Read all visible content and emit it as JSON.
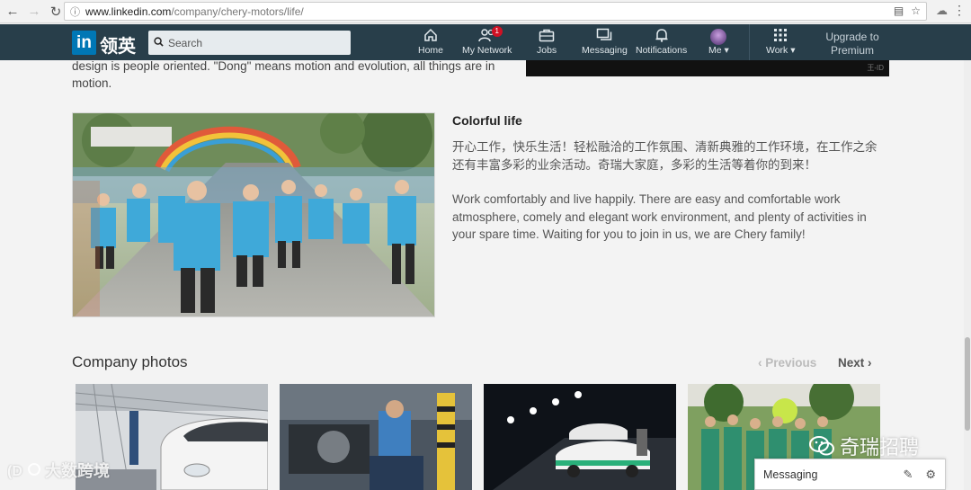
{
  "browser": {
    "back_icon": "back-arrow-icon",
    "forward_icon": "forward-arrow-icon",
    "reload_icon": "reload-icon",
    "url_host": "www.linkedin.com",
    "url_path": "/company/chery-motors/life/"
  },
  "linkedin_nav": {
    "logo_text": "in",
    "logo_cn": "领英",
    "search_placeholder": "Search",
    "items": [
      {
        "label": "Home",
        "icon": "home-icon"
      },
      {
        "label": "My Network",
        "icon": "network-icon",
        "badge": "1"
      },
      {
        "label": "Jobs",
        "icon": "briefcase-icon"
      },
      {
        "label": "Messaging",
        "icon": "messaging-icon"
      },
      {
        "label": "Notifications",
        "icon": "bell-icon"
      },
      {
        "label": "Me ▾",
        "icon": "avatar"
      },
      {
        "label": "Work ▾",
        "icon": "grid-icon"
      }
    ],
    "upgrade": "Upgrade to Premium"
  },
  "video_caption": "王-ID",
  "intro_text": "design is people oriented. \"Dong\" means motion and evolution, all things are in motion.",
  "colorful_life": {
    "title": "Colorful life",
    "cn_text": "开心工作，快乐生活！轻松融洽的工作氛围、清新典雅的工作环境，在工作之余还有丰富多彩的业余活动。奇瑞大家庭，多彩的生活等着你的到来！",
    "en_text": "Work comfortably and live happily. There are easy and comfortable work atmosphere, comely and elegant work environment, and plenty of activities in your spare time. Waiting for you to join in us, we are Chery family!"
  },
  "company_photos": {
    "title": "Company photos",
    "previous": "Previous",
    "next": "Next"
  },
  "watermarks": {
    "left": "大数跨境",
    "right": "奇瑞招聘"
  },
  "messaging_bar": {
    "label": "Messaging"
  },
  "colors": {
    "nav_bg": "#283e4a",
    "logo_blue": "#0077b5",
    "badge_red": "#d11124"
  }
}
